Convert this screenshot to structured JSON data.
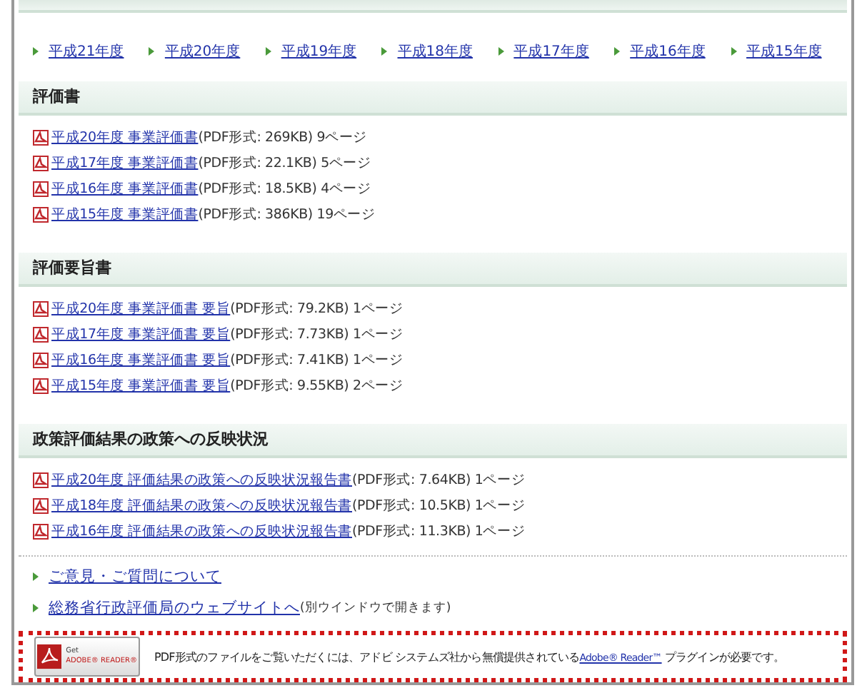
{
  "year_links": [
    {
      "label": "平成21年度"
    },
    {
      "label": "平成20年度"
    },
    {
      "label": "平成19年度"
    },
    {
      "label": "平成18年度"
    },
    {
      "label": "平成17年度"
    },
    {
      "label": "平成16年度"
    },
    {
      "label": "平成15年度"
    }
  ],
  "sections": [
    {
      "title": "評価書",
      "items": [
        {
          "link": "平成20年度 事業評価書",
          "info": "(PDF形式: 269KB) 9ページ"
        },
        {
          "link": "平成17年度 事業評価書",
          "info": "(PDF形式: 22.1KB) 5ページ"
        },
        {
          "link": "平成16年度 事業評価書",
          "info": "(PDF形式: 18.5KB) 4ページ"
        },
        {
          "link": "平成15年度 事業評価書",
          "info": "(PDF形式: 386KB) 19ページ"
        }
      ]
    },
    {
      "title": "評価要旨書",
      "items": [
        {
          "link": "平成20年度 事業評価書 要旨",
          "info": "(PDF形式: 79.2KB) 1ページ"
        },
        {
          "link": "平成17年度 事業評価書 要旨",
          "info": "(PDF形式: 7.73KB) 1ページ"
        },
        {
          "link": "平成16年度 事業評価書 要旨",
          "info": "(PDF形式: 7.41KB) 1ページ"
        },
        {
          "link": "平成15年度 事業評価書 要旨",
          "info": "(PDF形式: 9.55KB) 2ページ"
        }
      ]
    },
    {
      "title": "政策評価結果の政策への反映状況",
      "items": [
        {
          "link": "平成20年度 評価結果の政策への反映状況報告書",
          "info": "(PDF形式: 7.64KB) 1ページ"
        },
        {
          "link": "平成18年度 評価結果の政策への反映状況報告書",
          "info": "(PDF形式: 10.5KB) 1ページ"
        },
        {
          "link": "平成16年度 評価結果の政策への反映状況報告書",
          "info": "(PDF形式: 11.3KB) 1ページ"
        }
      ]
    }
  ],
  "footer_links": [
    {
      "link": "ご意見・ご質問について"
    },
    {
      "link": "総務省行政評価局のウェブサイトへ",
      "note": "(別ウインドウで開きます)"
    }
  ],
  "adobe_notice": {
    "badge_small": "Get",
    "badge_large": "ADOBE® READER®",
    "text_before": "PDF形式のファイルをご覧いただくには、アドビ システムズ社から無償提供されている",
    "link": "Adobe® Reader™",
    "text_after": " プラグインが必要です。"
  }
}
